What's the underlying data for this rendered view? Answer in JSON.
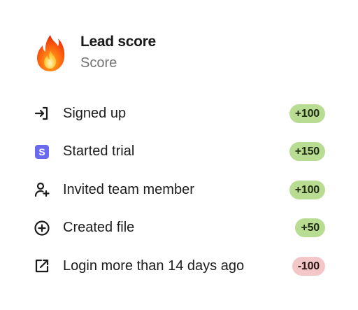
{
  "header": {
    "icon": "fire-icon",
    "title": "Lead score",
    "subtitle": "Score"
  },
  "colors": {
    "positive_badge": "#b9dc93",
    "negative_badge": "#f3c7c7",
    "trial_icon": "#6a6af0"
  },
  "rows": [
    {
      "icon": "sign-in-icon",
      "label": "Signed up",
      "score": "+100",
      "kind": "pos"
    },
    {
      "icon": "s-logo-icon",
      "label": "Started trial",
      "score": "+150",
      "kind": "pos"
    },
    {
      "icon": "user-plus-icon",
      "label": "Invited team member",
      "score": "+100",
      "kind": "pos"
    },
    {
      "icon": "plus-circle-icon",
      "label": "Created file",
      "score": "+50",
      "kind": "pos"
    },
    {
      "icon": "external-link-icon",
      "label": "Login more than 14 days ago",
      "score": "-100",
      "kind": "neg"
    }
  ]
}
